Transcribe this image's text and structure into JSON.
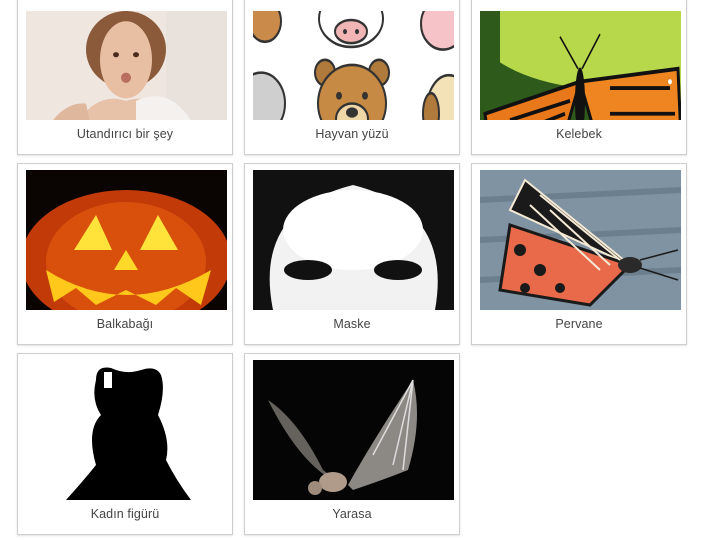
{
  "tiles": [
    {
      "label": "Utandırıcı bir şey",
      "icon": "embarrassed-woman-image"
    },
    {
      "label": "Hayvan yüzü",
      "icon": "animal-faces-image"
    },
    {
      "label": "Kelebek",
      "icon": "butterfly-image"
    },
    {
      "label": "Balkabağı",
      "icon": "pumpkin-image"
    },
    {
      "label": "Maske",
      "icon": "mask-image"
    },
    {
      "label": "Pervane",
      "icon": "moth-image"
    },
    {
      "label": "Kadın figürü",
      "icon": "woman-silhouette-image"
    },
    {
      "label": "Yarasa",
      "icon": "bat-image"
    }
  ]
}
